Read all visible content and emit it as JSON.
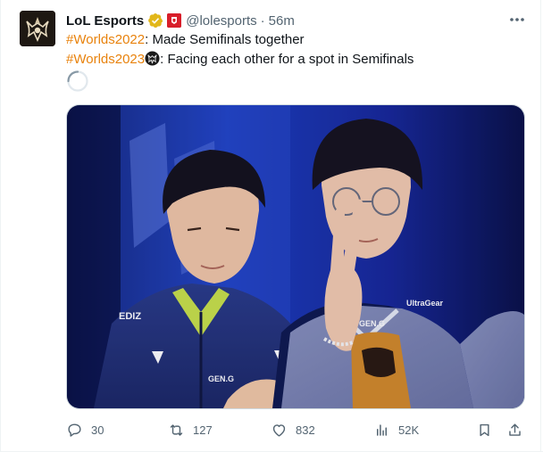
{
  "tweet": {
    "author_name": "LoL Esports",
    "handle": "@lolesports",
    "separator": "·",
    "time": "56m",
    "line1": {
      "hashtag": "#Worlds2022",
      "text": ": Made Semifinals together"
    },
    "line2": {
      "hashtag": "#Worlds2023",
      "text": ": Facing each other for a spot in Semifinals"
    },
    "media": {
      "jersey_text_left": "GEN.G",
      "jersey_text_right": "GEN.G",
      "sponsor": "UltraGear",
      "sleeve": "EDIZ"
    }
  },
  "actions": {
    "replies": "30",
    "reposts": "127",
    "likes": "832",
    "views": "52K"
  },
  "colors": {
    "hashtag": "#e8820c",
    "verified": "#e2b719",
    "affiliate": "#d81e2a",
    "muted": "#536471"
  }
}
